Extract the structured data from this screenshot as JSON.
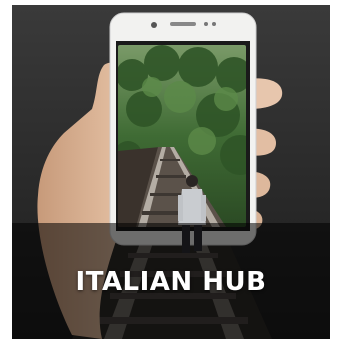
{
  "banner": {
    "title": "ITALIAN HUB"
  },
  "colors": {
    "background": "#262626",
    "overlay": "#000000",
    "title_text": "#ffffff",
    "phone_body": "#f2f2f0",
    "forest": "#3f6b34"
  },
  "image": {
    "icons": [
      "hand-holding-phone-icon",
      "person-walking-on-railway-icon"
    ]
  }
}
